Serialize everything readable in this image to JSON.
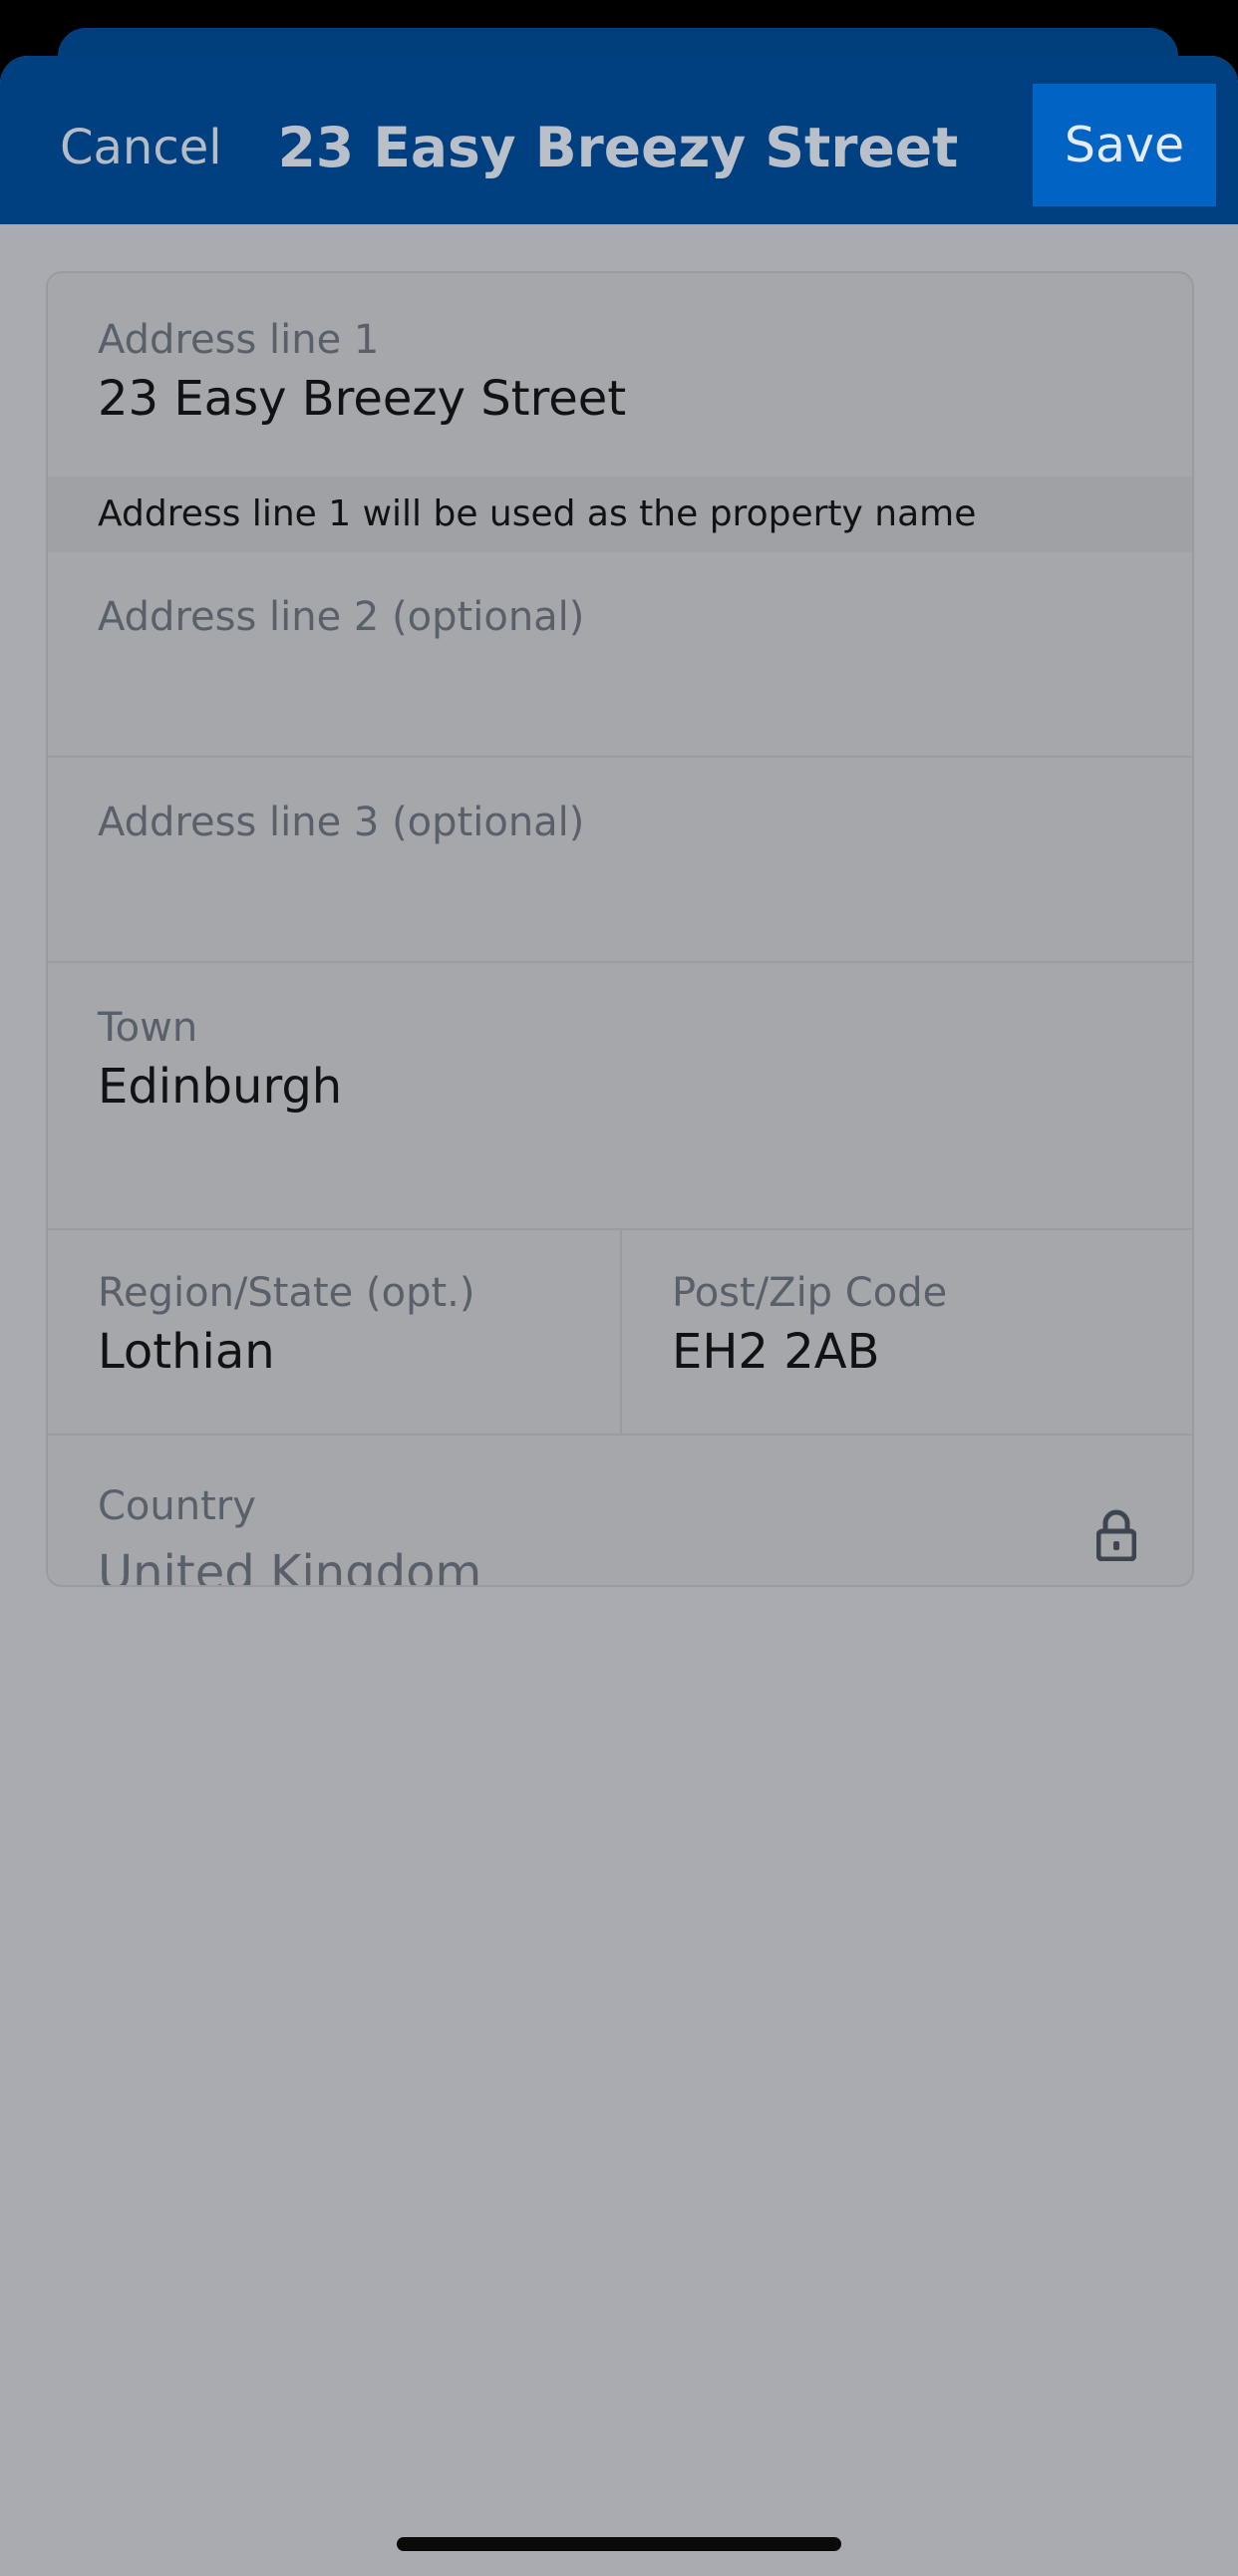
{
  "nav": {
    "cancel_label": "Cancel",
    "title": "23 Easy Breezy Street",
    "save_label": "Save"
  },
  "form": {
    "address_line_1": {
      "label": "Address line 1",
      "value": "23 Easy Breezy Street"
    },
    "hint": "Address line 1 will be used as the property name",
    "address_line_2": {
      "label": "Address line 2 (optional)",
      "value": ""
    },
    "address_line_3": {
      "label": "Address line 3 (optional)",
      "value": ""
    },
    "town": {
      "label": "Town",
      "value": "Edinburgh"
    },
    "region": {
      "label": "Region/State (opt.)",
      "value": "Lothian"
    },
    "postcode": {
      "label": "Post/Zip Code",
      "value": "EH2 2AB"
    },
    "country": {
      "label": "Country",
      "value": "United Kingdom",
      "icon": "lock-icon"
    }
  },
  "colors": {
    "navbar": "#003f80",
    "save_button": "#0164c5",
    "overlay_background": "#aaabb0"
  }
}
